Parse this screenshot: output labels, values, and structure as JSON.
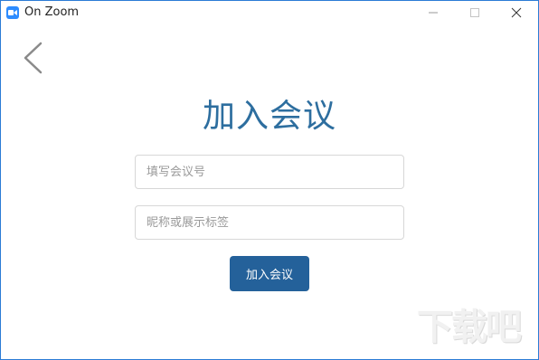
{
  "window": {
    "title": "On Zoom",
    "accent_color": "#2b7bd6",
    "app_icon": "zoom-camera-icon",
    "controls": {
      "minimize": "minimize-icon",
      "maximize": "maximize-icon",
      "close": "close-icon"
    }
  },
  "nav": {
    "back_icon": "chevron-left-icon"
  },
  "main": {
    "title": "加入会议",
    "meeting_id_placeholder": "填写会议号",
    "meeting_id_value": "",
    "name_placeholder": "昵称或展示标签",
    "name_value": "",
    "join_button_label": "加入会议",
    "join_button_color": "#24619a",
    "title_color": "#2d6e9f"
  },
  "watermark": {
    "text": "下载吧"
  }
}
